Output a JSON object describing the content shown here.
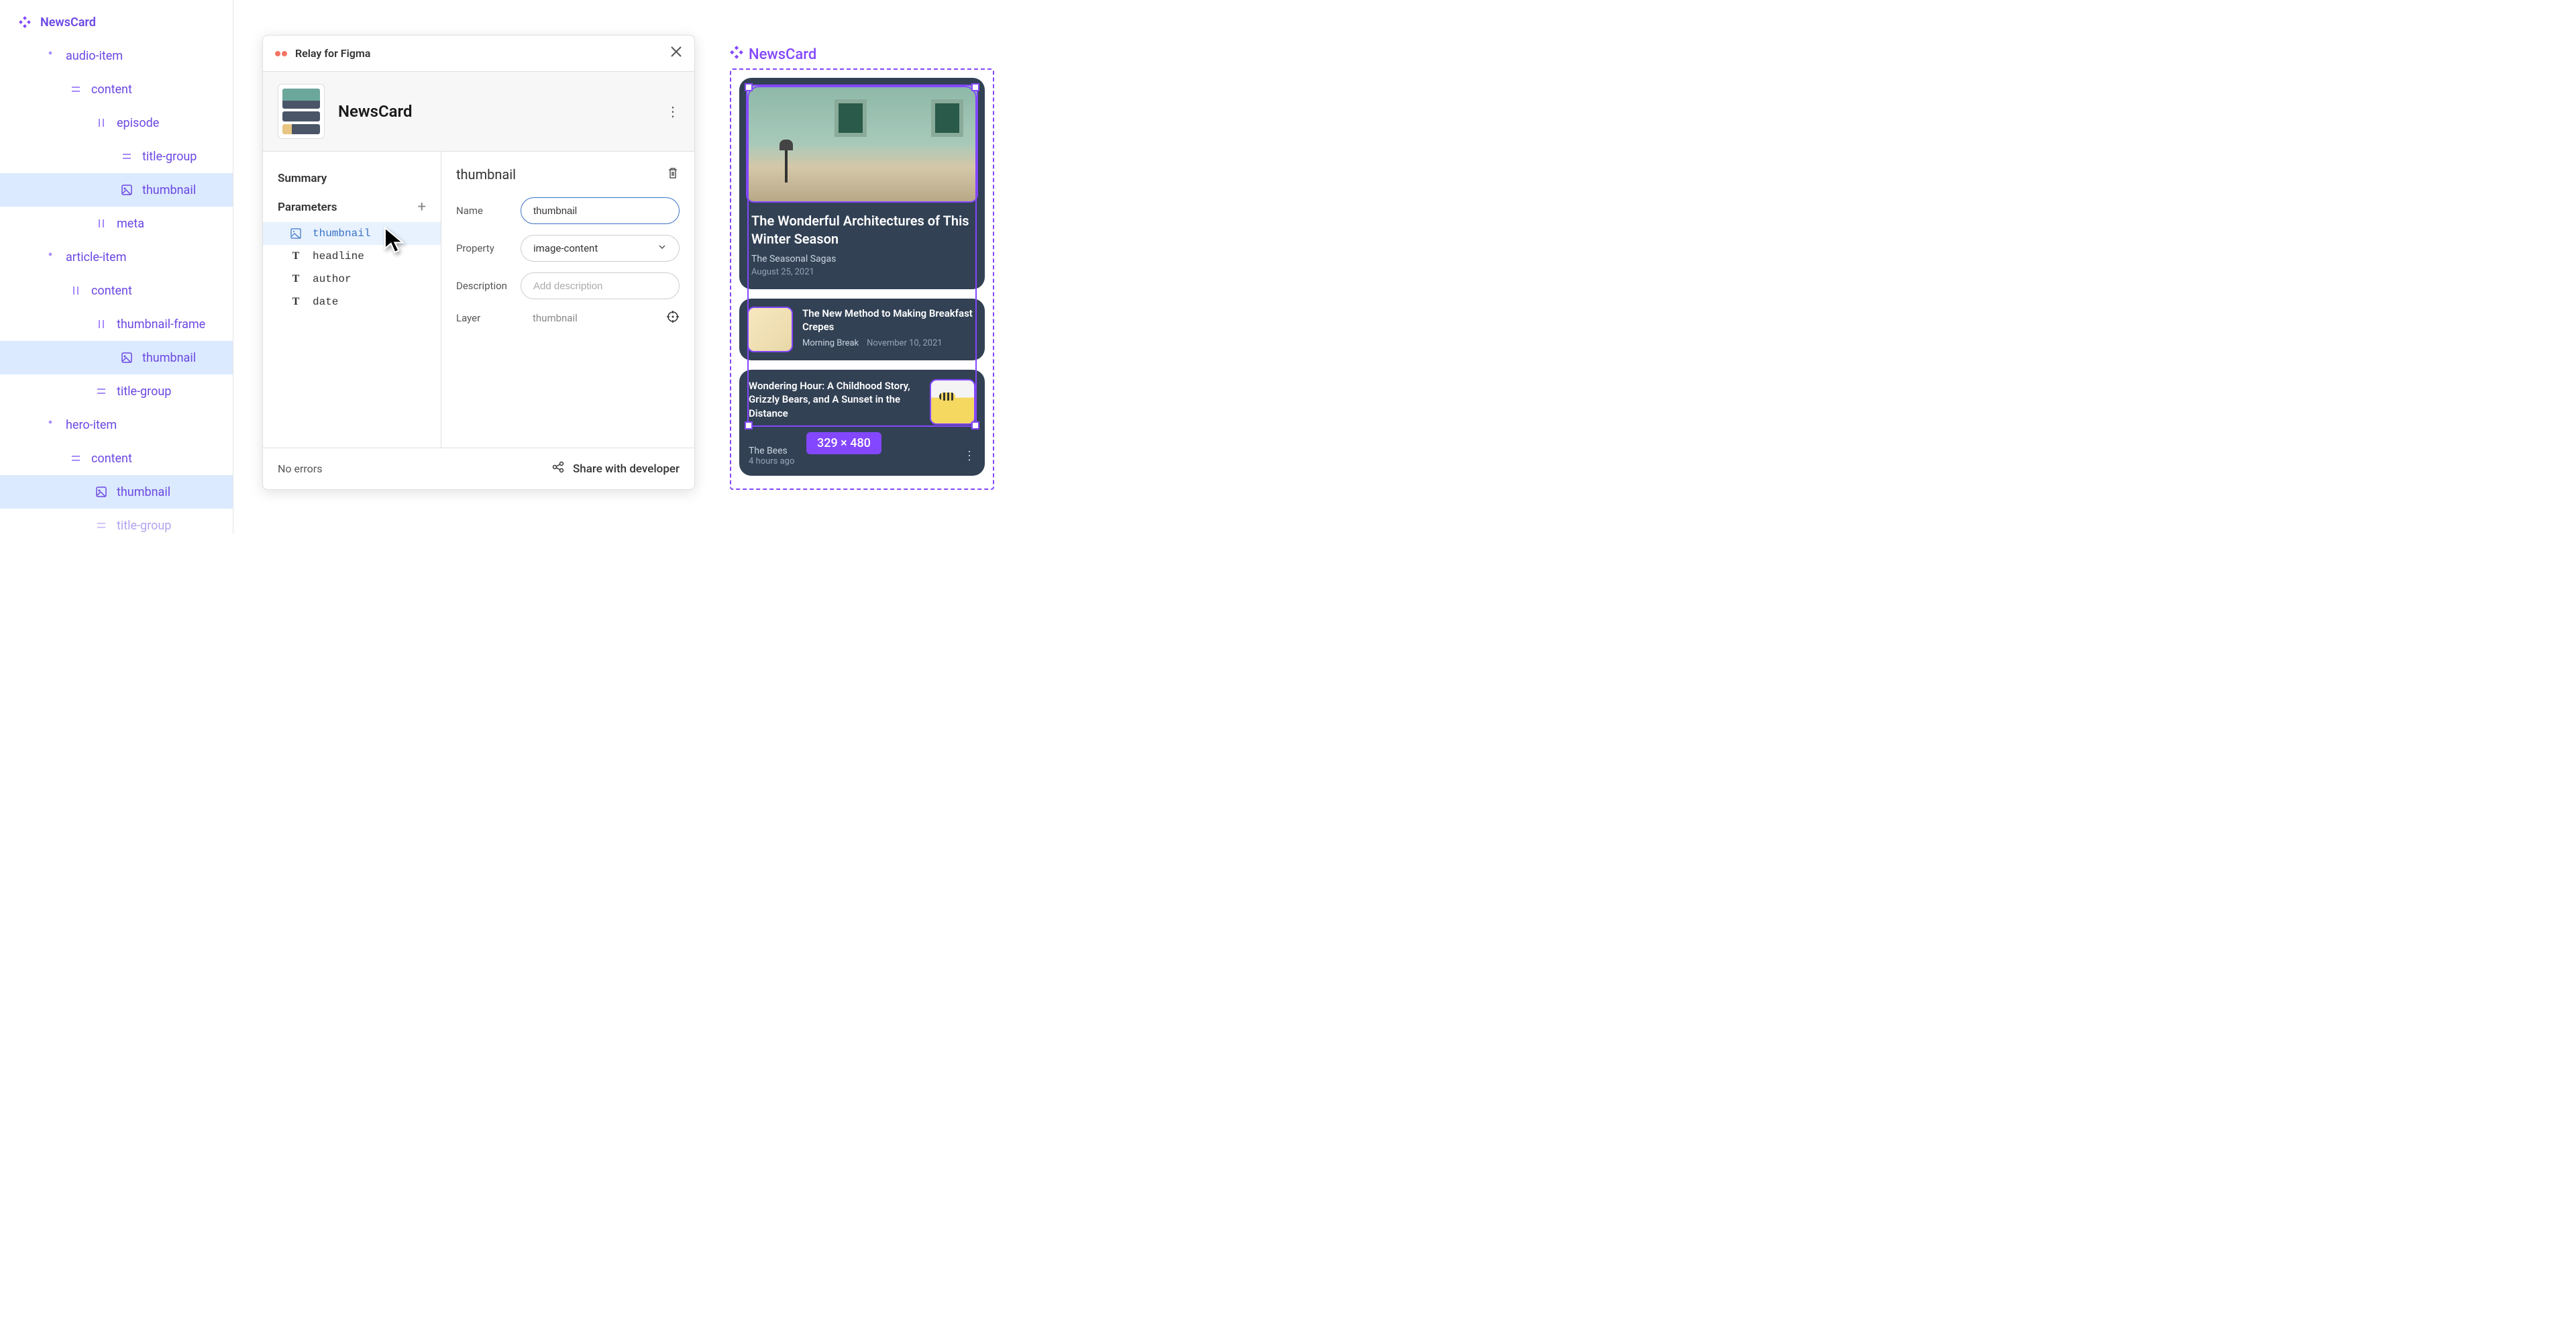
{
  "tree": {
    "root": "NewsCard",
    "items": [
      {
        "d": 1,
        "icon": "component",
        "label": "audio-item"
      },
      {
        "d": 2,
        "icon": "frame",
        "label": "content"
      },
      {
        "d": 3,
        "icon": "vframe",
        "label": "episode"
      },
      {
        "d": 4,
        "icon": "frame",
        "label": "title-group"
      },
      {
        "d": 4,
        "icon": "image",
        "label": "thumbnail",
        "selected": true
      },
      {
        "d": 3,
        "icon": "vframe",
        "label": "meta"
      },
      {
        "d": 1,
        "icon": "component",
        "label": "article-item"
      },
      {
        "d": 2,
        "icon": "vframe",
        "label": "content"
      },
      {
        "d": 3,
        "icon": "vframe",
        "label": "thumbnail-frame"
      },
      {
        "d": 4,
        "icon": "image",
        "label": "thumbnail",
        "selected": true
      },
      {
        "d": 3,
        "icon": "frame",
        "label": "title-group"
      },
      {
        "d": 1,
        "icon": "component",
        "label": "hero-item"
      },
      {
        "d": 2,
        "icon": "frame",
        "label": "content"
      },
      {
        "d": 3,
        "icon": "image",
        "label": "thumbnail",
        "selected": true
      },
      {
        "d": 3,
        "icon": "frame",
        "label": "title-group",
        "faded": true
      }
    ]
  },
  "plugin": {
    "title": "Relay for Figma",
    "component_name": "NewsCard",
    "sections": {
      "summary": "Summary",
      "parameters": "Parameters"
    },
    "params": [
      {
        "icon": "image",
        "label": "thumbnail",
        "selected": true
      },
      {
        "icon": "text",
        "label": "headline"
      },
      {
        "icon": "text",
        "label": "author"
      },
      {
        "icon": "text",
        "label": "date"
      }
    ],
    "detail": {
      "title": "thumbnail",
      "name_label": "Name",
      "name_value": "thumbnail",
      "property_label": "Property",
      "property_value": "image-content",
      "description_label": "Description",
      "description_placeholder": "Add description",
      "layer_label": "Layer",
      "layer_value": "thumbnail"
    },
    "footer": {
      "errors": "No errors",
      "share": "Share with developer"
    }
  },
  "canvas": {
    "frame_name": "NewsCard",
    "size_badge": "329 × 480",
    "hero": {
      "title": "The Wonderful Architectures of This Winter Season",
      "author": "The Seasonal Sagas",
      "date": "August 25, 2021"
    },
    "item1": {
      "title": "The New Method to Making Breakfast Crepes",
      "author": "Morning Break",
      "date": "November 10, 2021"
    },
    "item2": {
      "title": "Wondering Hour: A Childhood Story, Grizzly Bears, and A Sunset in the Distance",
      "author": "The Bees",
      "date": "4 hours ago"
    }
  }
}
